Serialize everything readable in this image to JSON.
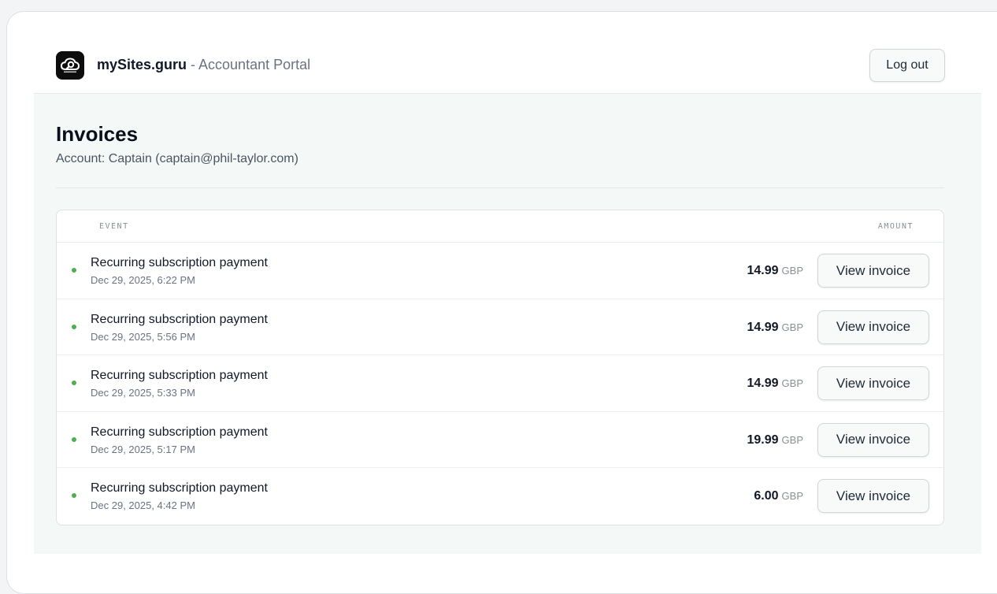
{
  "header": {
    "brand_name": "mySites.guru",
    "brand_suffix": " - Accountant Portal",
    "logout_label": "Log out"
  },
  "page": {
    "title": "Invoices",
    "account": "Account: Captain (captain@phil-taylor.com)"
  },
  "table": {
    "columns": [
      "EVENT",
      "AMOUNT"
    ],
    "rows": [
      {
        "event": "Recurring subscription payment",
        "date": "Dec 29, 2025, 6:22 PM",
        "amount": "14.99",
        "currency": "GBP",
        "action": "View invoice"
      },
      {
        "event": "Recurring subscription payment",
        "date": "Dec 29, 2025, 5:56 PM",
        "amount": "14.99",
        "currency": "GBP",
        "action": "View invoice"
      },
      {
        "event": "Recurring subscription payment",
        "date": "Dec 29, 2025, 5:33 PM",
        "amount": "14.99",
        "currency": "GBP",
        "action": "View invoice"
      },
      {
        "event": "Recurring subscription payment",
        "date": "Dec 29, 2025, 5:17 PM",
        "amount": "19.99",
        "currency": "GBP",
        "action": "View invoice"
      },
      {
        "event": "Recurring subscription payment",
        "date": "Dec 29, 2025, 4:42 PM",
        "amount": "6.00",
        "currency": "GBP",
        "action": "View invoice"
      }
    ]
  },
  "icons": {
    "logo": "cloud-magnifier-logo-icon",
    "status": "status-dot-icon"
  },
  "colors": {
    "status_dot": "#4caf50",
    "main_background": "#f4f9f8"
  }
}
